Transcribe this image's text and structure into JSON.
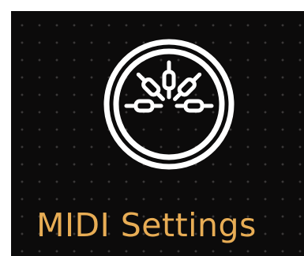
{
  "tile": {
    "title": "MIDI Settings",
    "icon": "midi-din-connector-icon"
  },
  "colors": {
    "background": "#0c0b0b",
    "dot_grid": "#3a3838",
    "icon": "#ffffff",
    "title": "#e8ad55"
  }
}
